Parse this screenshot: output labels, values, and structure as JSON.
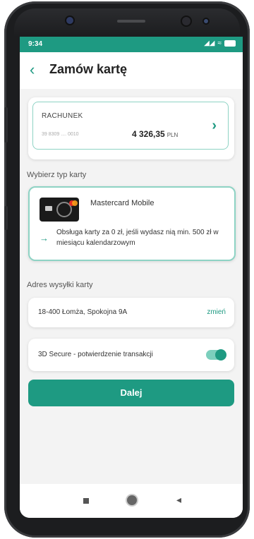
{
  "status": {
    "time": "9:34",
    "signal": "◢◢",
    "wifi": "≈"
  },
  "header": {
    "back_glyph": "‹",
    "title": "Zamów kartę"
  },
  "account": {
    "label": "RACHUNEK",
    "number": "39 8309 .... 0010",
    "balance": "4 326,35",
    "currency": "PLN",
    "chevron": "›"
  },
  "card_type": {
    "section_label": "Wybierz typ karty",
    "name": "Mastercard Mobile",
    "arrow": "→",
    "info": "Obsługa karty za 0 zł, jeśli wydasz nią min. 500 zł w miesiącu kalendarzowym"
  },
  "address": {
    "section_label": "Adres wysyłki karty",
    "value": "18-400 Łomża, Spokojna 9A",
    "change_label": "zmień"
  },
  "secure3d": {
    "label": "3D Secure - potwierdzenie transakcji",
    "enabled": true
  },
  "primary_button": {
    "label": "Dalej"
  },
  "colors": {
    "accent": "#1e9a82",
    "border": "#8ed3c4",
    "background": "#f3f3f3"
  },
  "navbar": {
    "back_glyph": "◂"
  }
}
